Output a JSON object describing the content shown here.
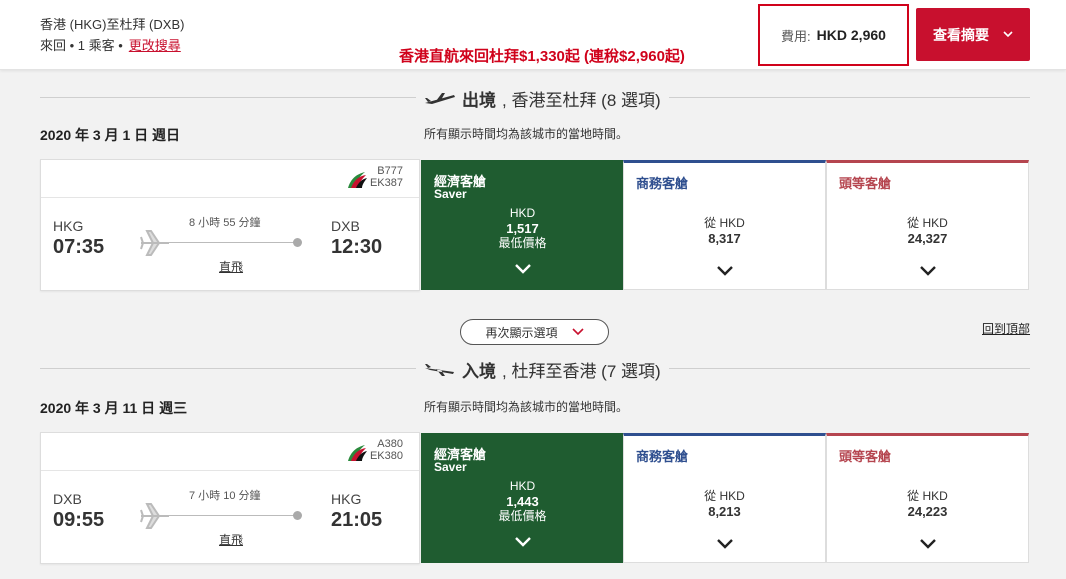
{
  "header": {
    "route": "香港 (HKG)至杜拜 (DXB)",
    "trip_info": "來回 • 1 乘客 •",
    "change_search": "更改搜尋",
    "promo": "香港直航來回杜拜$1,330起 (連稅$2,960起)",
    "cost_label": "費用:",
    "cost_amount": "HKD 2,960",
    "summary_label": "查看摘要"
  },
  "outbound": {
    "title_bold": "出境",
    "title_rest": ", 香港至杜拜 (8 選項)",
    "date": "2020 年 3 月 1 日 週日",
    "note": "所有顯示時間均為該城市的當地時間。",
    "aircraft": "B777",
    "flight_no": "EK387",
    "from_code": "HKG",
    "from_time": "07:35",
    "to_code": "DXB",
    "to_time": "12:30",
    "duration": "8 小時 55 分鐘",
    "stops": "直飛",
    "fares": {
      "economy": {
        "class": "經濟客艙",
        "tier": "Saver",
        "currency": "HKD",
        "price": "1,517",
        "tag": "最低價格"
      },
      "business": {
        "class": "商務客艙",
        "from": "從 HKD",
        "price": "8,317"
      },
      "first": {
        "class": "頭等客艙",
        "from": "從 HKD",
        "price": "24,327"
      }
    }
  },
  "reshow_label": "再次顯示選項",
  "back_to_top": "回到頂部",
  "inbound": {
    "title_bold": "入境",
    "title_rest": ", 杜拜至香港 (7 選項)",
    "date": "2020 年 3 月 11 日 週三",
    "note": "所有顯示時間均為該城市的當地時間。",
    "aircraft": "A380",
    "flight_no": "EK380",
    "from_code": "DXB",
    "from_time": "09:55",
    "to_code": "HKG",
    "to_time": "21:05",
    "duration": "7 小時 10 分鐘",
    "stops": "直飛",
    "fares": {
      "economy": {
        "class": "經濟客艙",
        "tier": "Saver",
        "currency": "HKD",
        "price": "1,443",
        "tag": "最低價格"
      },
      "business": {
        "class": "商務客艙",
        "from": "從 HKD",
        "price": "8,213"
      },
      "first": {
        "class": "頭等客艙",
        "from": "從 HKD",
        "price": "24,223"
      }
    }
  },
  "colors": {
    "brand_red": "#c8102e",
    "economy_green": "#1f5c30",
    "business_blue": "#2f4f8f",
    "first_red": "#b5454f"
  },
  "icons": [
    "airplane-icon",
    "emirates-logo-icon",
    "chevron-down-icon"
  ]
}
